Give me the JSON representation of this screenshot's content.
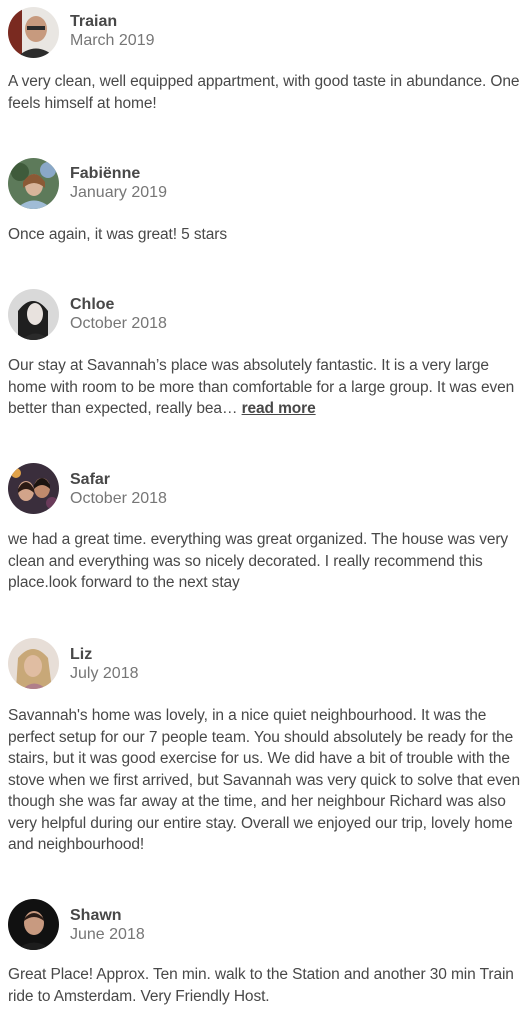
{
  "reviews": [
    {
      "name": "Traian",
      "date": "March 2019",
      "text": "A very clean, well equipped appartment, with good taste in abundance. One feels himself at home!"
    },
    {
      "name": "Fabiënne",
      "date": "January 2019",
      "text": "Once again, it was great! 5 stars"
    },
    {
      "name": "Chloe",
      "date": "October 2018",
      "text": "Our stay at Savannah’s place was absolutely fantastic. It is a very large home with room to be more than comfortable for a large group. It was even better than expected, really bea…",
      "read_more": "read more"
    },
    {
      "name": "Safar",
      "date": "October 2018",
      "text": "we had a great time. everything was great organized. The house was very clean and everything was so nicely decorated. I really recommend this place.look forward to the next stay"
    },
    {
      "name": "Liz",
      "date": "July 2018",
      "text": "Savannah's home was lovely, in a nice quiet neighbourhood. It was the perfect setup for our 7 people team. You should absolutely be ready for the stairs, but it was good exercise for us. We did have a bit of trouble with the stove when we first arrived, but Savannah was very quick to solve that even though she was far away at the time, and her neighbour Richard was also very helpful during our entire stay. Overall we enjoyed our trip, lovely home and neighbourhood!"
    },
    {
      "name": "Shawn",
      "date": "June 2018",
      "text": "Great Place! Approx. Ten min. walk to the Station and another 30 min Train ride to Amsterdam. Very Friendly Host."
    }
  ]
}
